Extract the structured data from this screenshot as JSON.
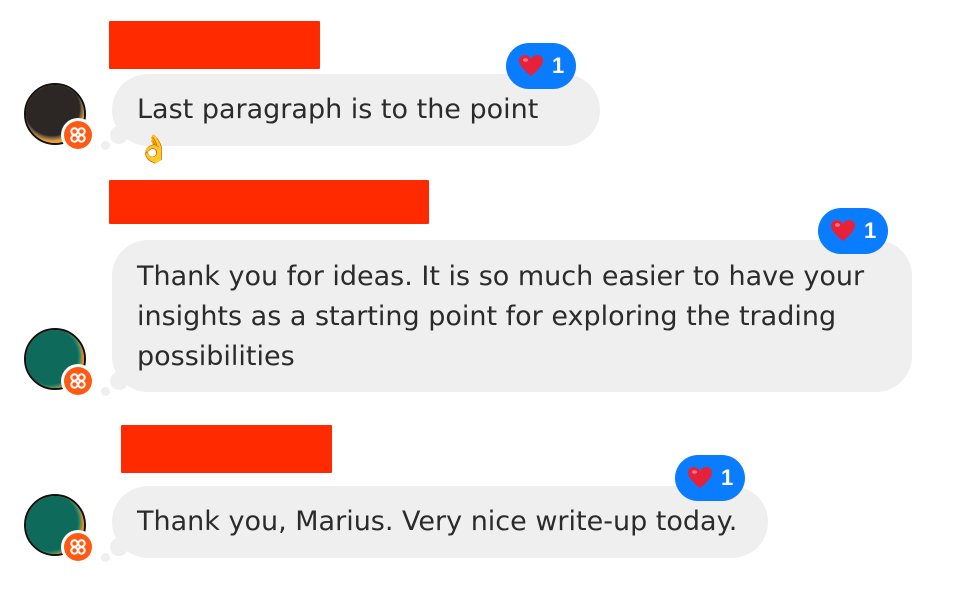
{
  "colors": {
    "redaction": "#ff2a00",
    "bubble_bg": "#efefef",
    "reaction_bg": "#0a7cff",
    "heart": "#e8213b",
    "badge": "#ff5a14",
    "avatar_dark": "#2c2724",
    "avatar_teal": "#0e6a5a",
    "avatar_orange": "#f08a24"
  },
  "messages": [
    {
      "text": "Last paragraph is to the point 👌",
      "reaction_icon": "heart-emoji",
      "reaction_count": "1",
      "avatar_style": "dark"
    },
    {
      "text": "Thank you for ideas. It is so much easier to have your insights as a starting point for exploring the trading possibilities",
      "reaction_icon": "heart-emoji",
      "reaction_count": "1",
      "avatar_style": "teal"
    },
    {
      "text": "Thank you, Marius. Very nice write-up today.",
      "reaction_icon": "heart-emoji",
      "reaction_count": "1",
      "avatar_style": "teal"
    }
  ]
}
